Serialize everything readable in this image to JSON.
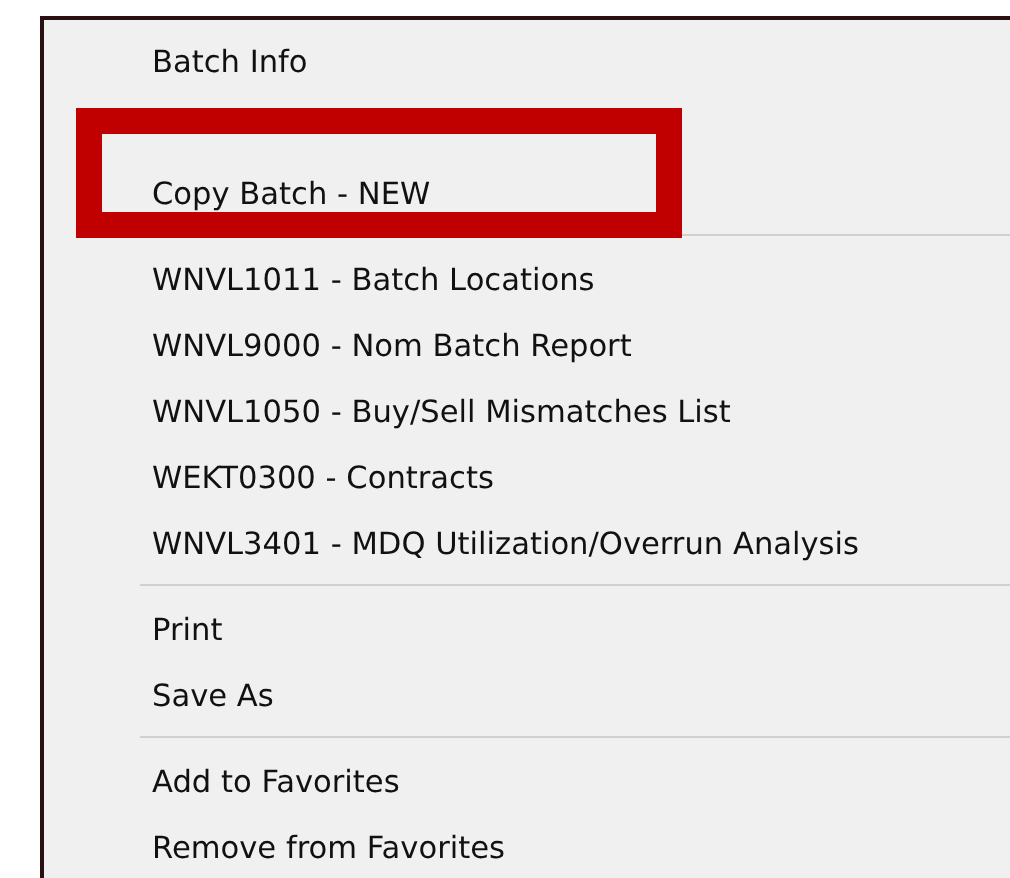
{
  "menu": {
    "groups": [
      {
        "items": [
          {
            "kind": "item",
            "label": "Batch Info",
            "highlighted": false
          },
          {
            "kind": "obscured"
          },
          {
            "kind": "item",
            "label": "Copy Batch - NEW",
            "highlighted": true
          }
        ]
      },
      {
        "items": [
          {
            "kind": "item",
            "label": "WNVL1011 - Batch Locations",
            "highlighted": false
          },
          {
            "kind": "item",
            "label": "WNVL9000 - Nom Batch Report",
            "highlighted": false
          },
          {
            "kind": "item",
            "label": "WNVL1050 - Buy/Sell Mismatches List",
            "highlighted": false
          },
          {
            "kind": "item",
            "label": "WEKT0300 - Contracts",
            "highlighted": false
          },
          {
            "kind": "item",
            "label": "WNVL3401 - MDQ Utilization/Overrun Analysis",
            "highlighted": false
          }
        ]
      },
      {
        "items": [
          {
            "kind": "item",
            "label": "Print",
            "highlighted": false
          },
          {
            "kind": "item",
            "label": "Save As",
            "highlighted": false
          }
        ]
      },
      {
        "items": [
          {
            "kind": "item",
            "label": "Add to Favorites",
            "highlighted": false
          },
          {
            "kind": "item",
            "label": "Remove from Favorites",
            "highlighted": false
          }
        ]
      }
    ]
  }
}
